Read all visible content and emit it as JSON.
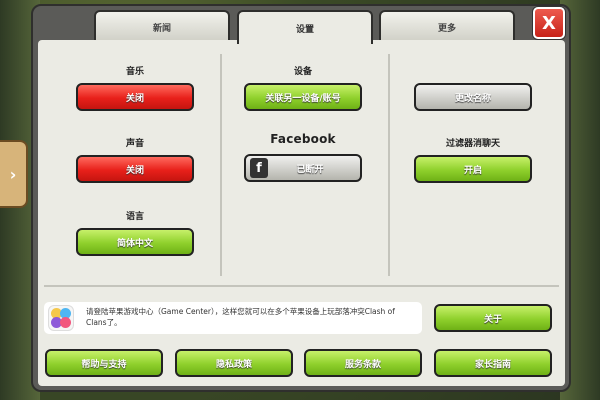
{
  "tabs": [
    {
      "label": "新闻"
    },
    {
      "label": "设置"
    },
    {
      "label": "更多"
    }
  ],
  "close_label": "X",
  "side_arrow": "›",
  "sections": {
    "music": {
      "label": "音乐",
      "button": "关闭"
    },
    "sound": {
      "label": "声音",
      "button": "关闭"
    },
    "language": {
      "label": "语言",
      "button": "简体中文"
    },
    "device": {
      "label": "设备",
      "button": "关联另一设备/账号"
    },
    "facebook": {
      "label": "Facebook",
      "button": "已断开"
    },
    "rename": {
      "button": "更改名称"
    },
    "chat_filter": {
      "label": "过滤器消聊天",
      "button": "开启"
    }
  },
  "game_center": {
    "text": "请登陆苹果游戏中心（Game Center），这样您就可以在多个苹果设备上玩部落冲突Clash of Clans了。",
    "about_button": "关于"
  },
  "bottom_buttons": [
    "帮助与支持",
    "隐私政策",
    "服务条款",
    "家长指南"
  ],
  "colors": {
    "red": "#e8201a",
    "green": "#8fd02c",
    "gray": "#cfcfca",
    "panel": "#ebebe4"
  }
}
